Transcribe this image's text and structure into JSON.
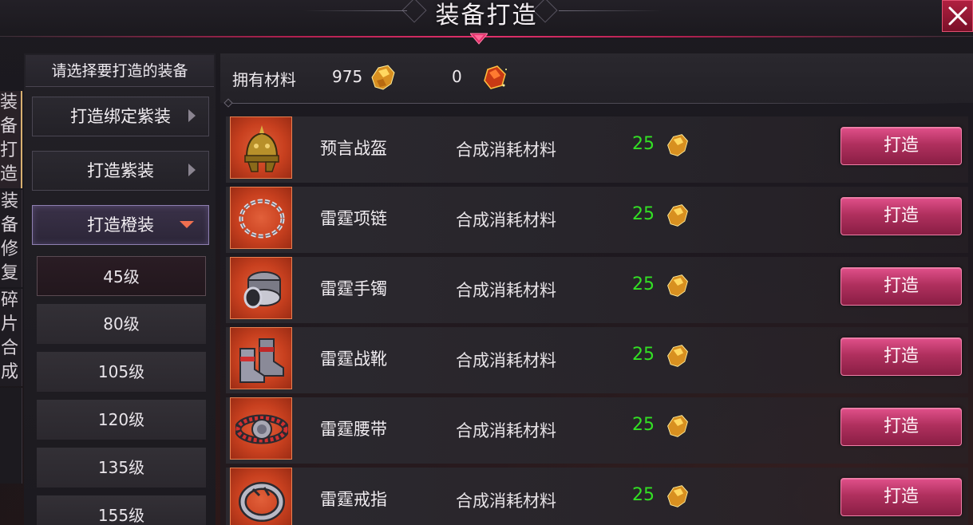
{
  "window": {
    "title": "装备打造"
  },
  "side_tabs": [
    {
      "label": "装备打造",
      "chars": [
        "装",
        "备",
        "打",
        "造"
      ]
    },
    {
      "label": "装备修复",
      "chars": [
        "装",
        "备",
        "修",
        "复"
      ]
    },
    {
      "label": "碎片合成",
      "chars": [
        "碎",
        "片",
        "合",
        "成"
      ]
    }
  ],
  "category_panel": {
    "header": "请选择要打造的装备",
    "categories": [
      "打造绑定紫装",
      "打造紫装",
      "打造橙装"
    ],
    "levels": [
      "45级",
      "80级",
      "105级",
      "120级",
      "135级",
      "155级"
    ]
  },
  "materials": {
    "label": "拥有材料",
    "count_primary": "975",
    "count_secondary": "0"
  },
  "items": [
    {
      "name": "预言战盔",
      "desc": "合成消耗材料",
      "cost": "25",
      "button": "打造",
      "icon": "helmet-icon"
    },
    {
      "name": "雷霆项链",
      "desc": "合成消耗材料",
      "cost": "25",
      "button": "打造",
      "icon": "necklace-icon"
    },
    {
      "name": "雷霆手镯",
      "desc": "合成消耗材料",
      "cost": "25",
      "button": "打造",
      "icon": "bracelet-icon"
    },
    {
      "name": "雷霆战靴",
      "desc": "合成消耗材料",
      "cost": "25",
      "button": "打造",
      "icon": "boots-icon"
    },
    {
      "name": "雷霆腰带",
      "desc": "合成消耗材料",
      "cost": "25",
      "button": "打造",
      "icon": "belt-icon"
    },
    {
      "name": "雷霆戒指",
      "desc": "合成消耗材料",
      "cost": "25",
      "button": "打造",
      "icon": "ring-icon"
    }
  ],
  "colors": {
    "accent": "#c0305e",
    "cost_green": "#33e024",
    "item_frame_orange": "#d04a26"
  }
}
